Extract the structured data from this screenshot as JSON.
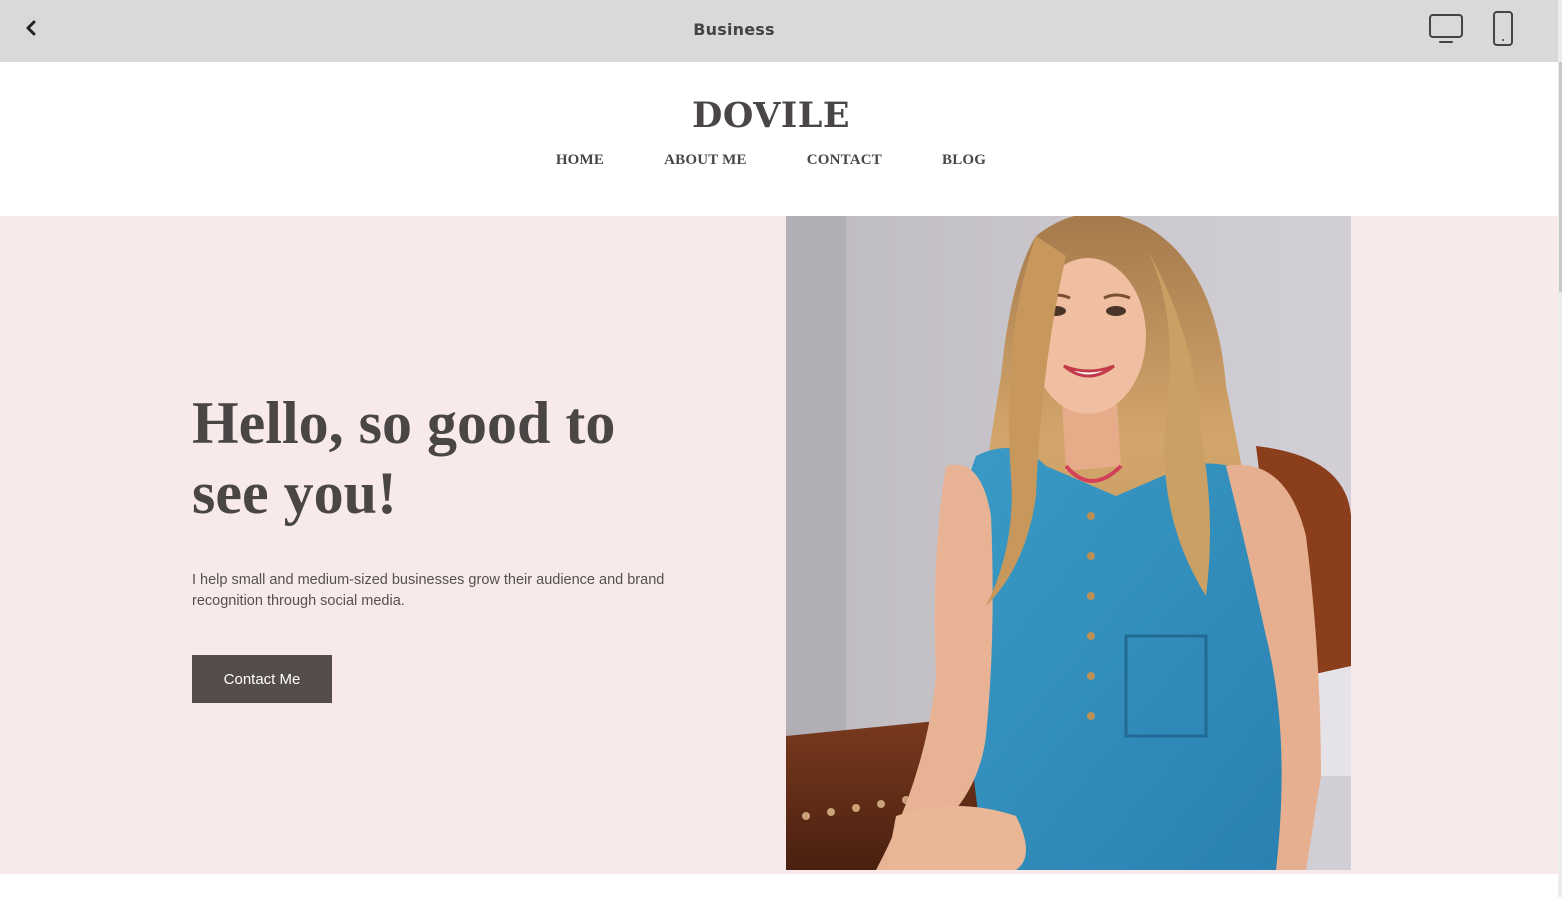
{
  "toolbar": {
    "title": "Business",
    "back_icon": "chevron-left-icon",
    "desktop_icon": "desktop-monitor-icon",
    "mobile_icon": "mobile-phone-icon"
  },
  "site": {
    "logo": "DOVILE",
    "nav": [
      "HOME",
      "ABOUT ME",
      "CONTACT",
      "BLOG"
    ]
  },
  "hero": {
    "heading": "Hello, so good to see you!",
    "text": "I help small and medium-sized businesses grow their audience and brand recognition through social media.",
    "button_label": "Contact Me",
    "photo": "portrait-photo"
  },
  "colors": {
    "toolbar_bg": "#d9d9d9",
    "hero_bg": "#f8eaea",
    "text_dark": "#4a4646",
    "button_bg": "#554d4c"
  }
}
